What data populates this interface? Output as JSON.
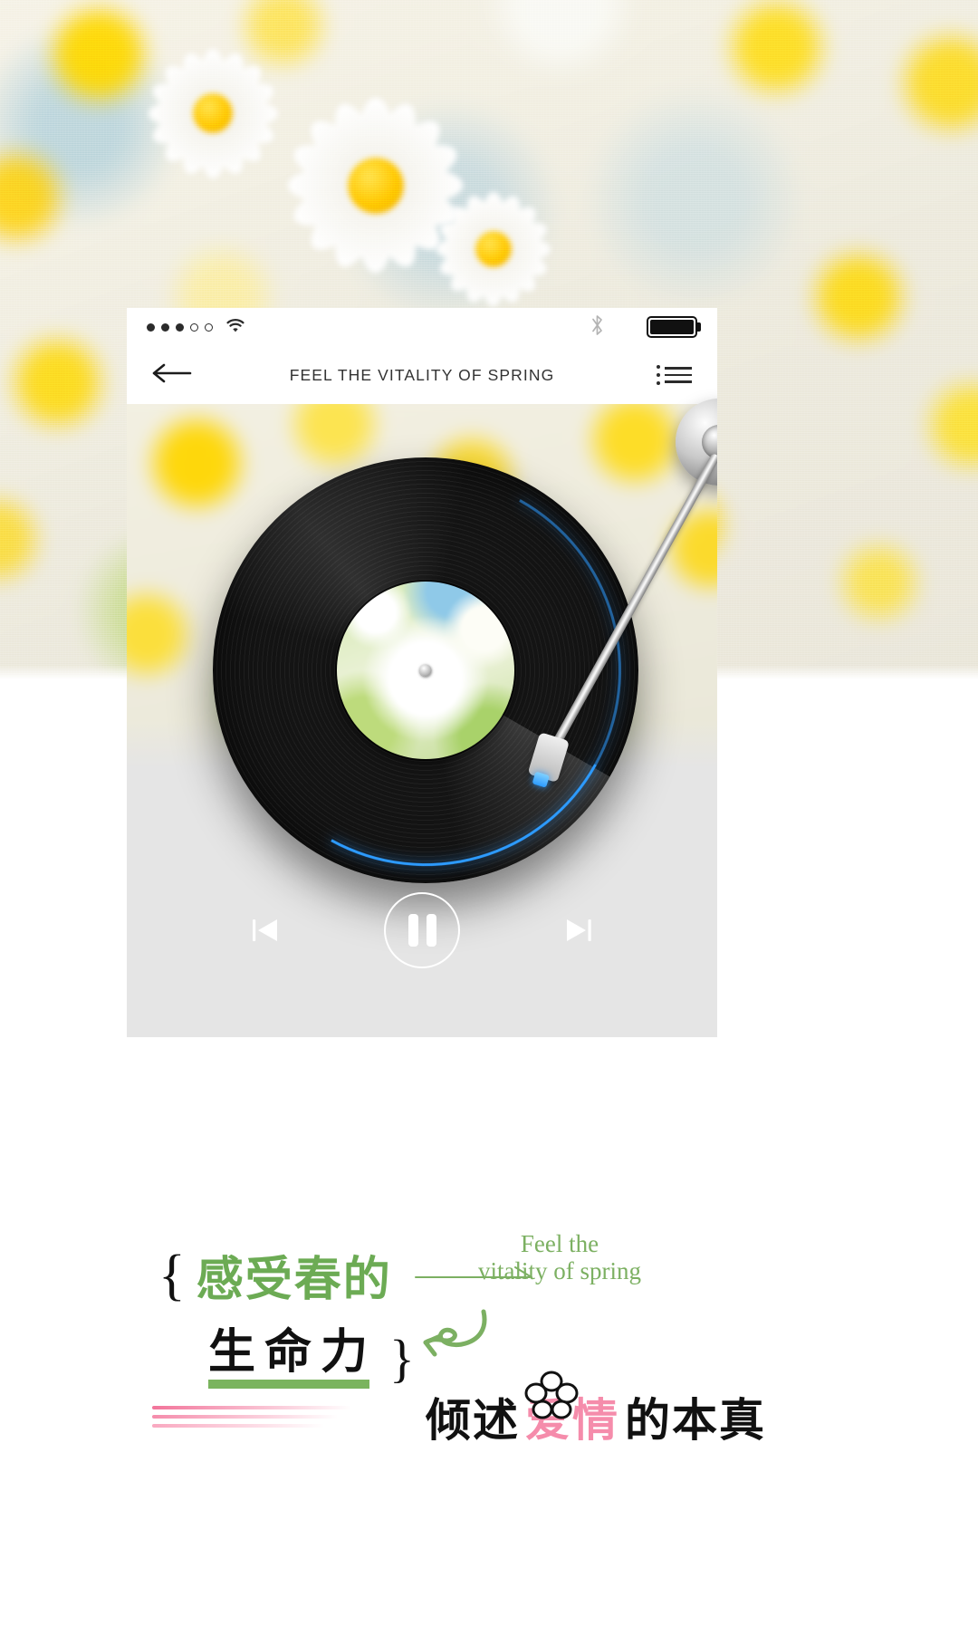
{
  "page": {
    "kind": "music-player-poster",
    "background_photo": "daisy-flowers-blurred"
  },
  "status_bar": {
    "signal_dots_total": 5,
    "signal_dots_filled": 3,
    "wifi_icon": "wifi-icon",
    "bluetooth_icon": "bluetooth-icon",
    "battery_icon": "battery-full-icon",
    "battery_level_percent": 100
  },
  "nav_bar": {
    "back_icon": "back-arrow-icon",
    "title": "FEEL THE VITALITY OF SPRING",
    "menu_icon": "list-menu-icon"
  },
  "player": {
    "turntable": {
      "vinyl_icon": "vinyl-record-icon",
      "tonearm_icon": "tonearm-icon",
      "album_art": "daisy-flower-album-art",
      "progress_arc_color": "#2d9bff"
    },
    "controls": [
      {
        "name": "previous-track-button",
        "icon": "skip-previous-icon",
        "label": "Previous"
      },
      {
        "name": "play-pause-button",
        "icon": "pause-icon",
        "label": "Pause",
        "state": "playing"
      },
      {
        "name": "next-track-button",
        "icon": "skip-next-icon",
        "label": "Next"
      }
    ],
    "panel_bg_color": "#e5e5e5"
  },
  "copy": {
    "brace_open": "{",
    "brace_close": "}",
    "line1_cn": "感受春的",
    "line2_cn": "生命力",
    "script_line1": "Feel the",
    "script_line2": "vitality of spring",
    "tagline_prefix": "倾述",
    "tagline_highlight": "爱情",
    "tagline_suffix": "的本真",
    "arrow_icon": "long-arrow-right-icon",
    "curl_icon": "curly-arrow-left-icon",
    "flower_icon": "flower-outline-icon",
    "green": "#6cab54",
    "green_underline": "#7ab45e",
    "pink": "#f58cab",
    "black": "#111111"
  }
}
